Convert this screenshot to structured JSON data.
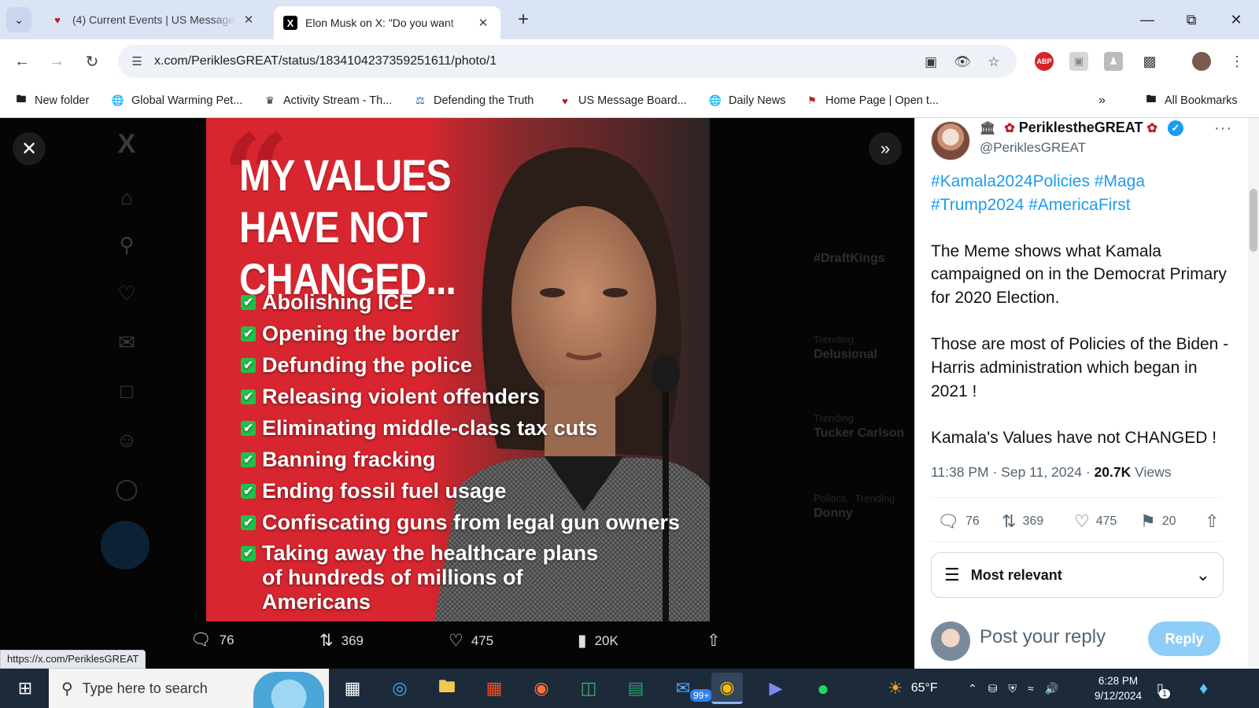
{
  "browser": {
    "tabs": [
      {
        "title": "(4) Current Events | US Message",
        "favicon": "message-board-favicon"
      },
      {
        "title": "Elon Musk on X: \"Do you want",
        "favicon": "x-logo"
      }
    ],
    "url": "x.com/PeriklesGREAT/status/1834104237359251611/photo/1",
    "bookmarks": [
      {
        "label": "New folder",
        "icon": "folder-icon"
      },
      {
        "label": "Global Warming Pet...",
        "icon": "globe-icon"
      },
      {
        "label": "Activity Stream - Th...",
        "icon": "activity-icon"
      },
      {
        "label": "Defending the Truth",
        "icon": "shield-icon"
      },
      {
        "label": "US Message Board...",
        "icon": "message-board-favicon"
      },
      {
        "label": "Daily News",
        "icon": "globe-icon"
      },
      {
        "label": "Home Page | Open t...",
        "icon": "home-favicon"
      }
    ],
    "all_bookmarks": "All Bookmarks",
    "status_url": "https://x.com/PeriklesGREAT"
  },
  "meme": {
    "headline": "MY VALUES HAVE NOT CHANGED...",
    "items": [
      "Abolishing ICE",
      "Opening the border",
      "Defunding the police",
      "Releasing violent offenders",
      "Eliminating middle-class tax cuts",
      "Banning fracking",
      "Ending fossil fuel usage",
      "Confiscating guns from legal gun owners",
      "Taking away the healthcare plans of hundreds of millions of Americans"
    ]
  },
  "viewer_actions": {
    "replies": "76",
    "reposts": "369",
    "likes": "475",
    "views": "20K"
  },
  "tweet": {
    "display_name": "PeriklestheGREAT",
    "handle": "@PeriklesGREAT",
    "hashtags": "#Kamala2024Policies #Maga #Trump2024 #AmericaFirst",
    "paragraphs": [
      "The Meme shows what Kamala campaigned on in the Democrat Primary for 2020 Election.",
      "Those are most of  Policies of the Biden - Harris administration  which began in 2021 !",
      "Kamala's Values have not CHANGED !"
    ],
    "time": "11:38 PM · Sep 11, 2024 · ",
    "views_count": "20.7K",
    "views_label": " Views",
    "stats": {
      "replies": "76",
      "reposts": "369",
      "likes": "475",
      "bookmarks": "20"
    },
    "sort_label": "Most relevant",
    "reply_placeholder": "Post your reply",
    "reply_button": "Reply"
  },
  "background_trends": [
    {
      "meta": "",
      "title": "#DraftKings",
      "count": ""
    },
    {
      "meta": "Trending",
      "title": "Delusional",
      "count": ""
    },
    {
      "meta": "Trending",
      "title": "Tucker Carlson",
      "count": ""
    },
    {
      "meta": "Politics · Trending",
      "title": "Donny",
      "count": ""
    }
  ],
  "taskbar": {
    "search_placeholder": "Type here to search",
    "weather": "65°F",
    "time": "6:28 PM",
    "date": "9/12/2024",
    "mail_badge": "99+",
    "notification_badge": "1"
  },
  "colors": {
    "accent": "#1d9bf0",
    "meme_red": "#d7262f",
    "check_green": "#21c04a"
  }
}
